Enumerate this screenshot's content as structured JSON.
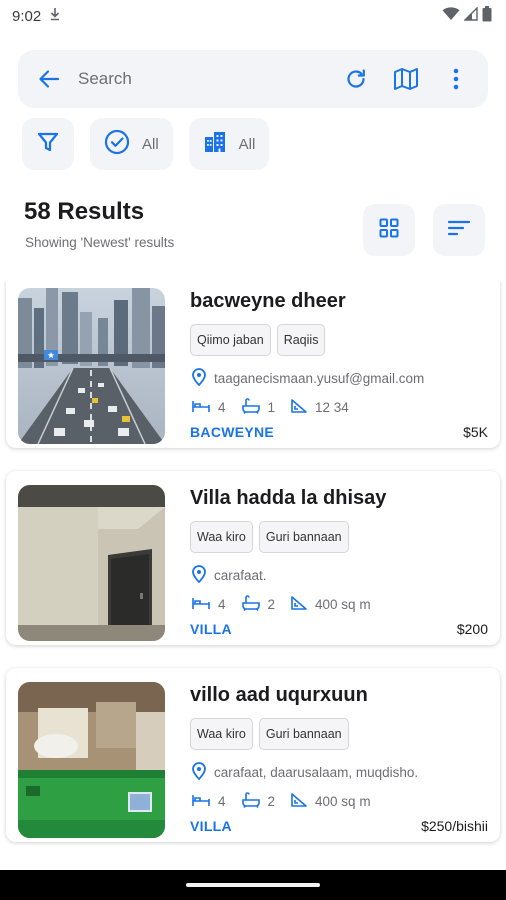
{
  "status_bar": {
    "time": "9:02"
  },
  "search": {
    "placeholder": "Search"
  },
  "filters": {
    "status_label": "All",
    "type_label": "All"
  },
  "results": {
    "title": "58 Results",
    "subtitle": "Showing 'Newest' results"
  },
  "listings": [
    {
      "title": "bacweyne dheer",
      "tags": [
        "Qiimo jaban",
        "Raqiis"
      ],
      "location": "taaganecismaan.yusuf@gmail.com",
      "bedrooms": "4",
      "bathrooms": "1",
      "area": "12 34",
      "type": "BACWEYNE",
      "price": "$5K"
    },
    {
      "title": "Villa hadda la dhisay",
      "tags": [
        "Waa kiro",
        "Guri bannaan"
      ],
      "location": "carafaat.",
      "bedrooms": "4",
      "bathrooms": "2",
      "area": "400 sq m",
      "type": "VILLA",
      "price": "$200"
    },
    {
      "title": "villo aad uqurxuun",
      "tags": [
        "Waa kiro",
        "Guri bannaan"
      ],
      "location": "carafaat, daarusalaam, muqdisho.",
      "bedrooms": "4",
      "bathrooms": "2",
      "area": "400 sq m",
      "type": "VILLA",
      "price": "$250/bishii"
    }
  ],
  "colors": {
    "accent": "#1a73e8",
    "surface": "#f3f4f7"
  }
}
